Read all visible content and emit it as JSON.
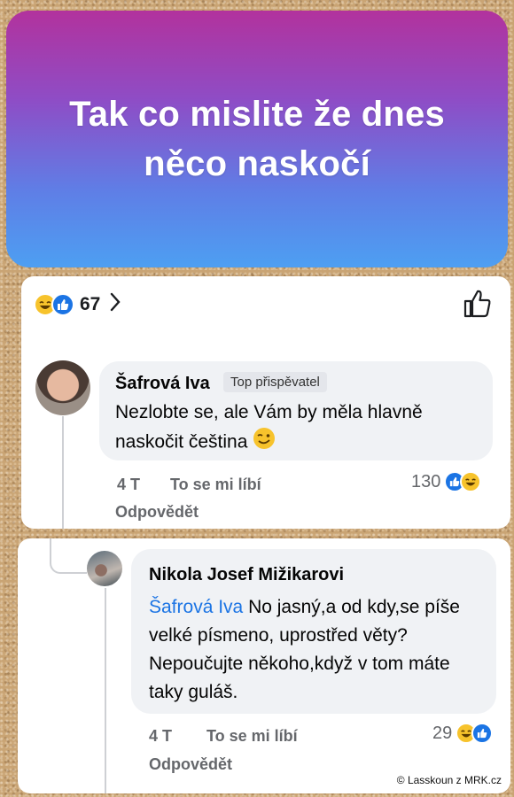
{
  "banner": {
    "text": "Tak co mislite že dnes něco naskočí"
  },
  "post": {
    "reaction_count": "67"
  },
  "comment1": {
    "author": "Šafrová Iva",
    "badge": "Top přispěvatel",
    "text": "Nezlobte se, ale Vám by měla hlavně naskočit čeština",
    "time": "4 T",
    "like_label": "To se mi líbí",
    "reply_label": "Odpovědět",
    "reaction_count": "130"
  },
  "comment2": {
    "author": "Nikola Josef Mižikarovi",
    "mention": "Šafrová Iva",
    "text": " No jasný,a od kdy,se píše velké písmeno, uprostřed věty? Nepoučujte někoho,když v tom máte taky guláš.",
    "time": "4 T",
    "like_label": "To se mi líbí",
    "reply_label": "Odpovědět",
    "reaction_count": "29"
  },
  "watermark": "© Lasskoun z MRK.cz",
  "colors": {
    "like_blue": "#1b74e4",
    "haha_yellow": "#f7c32c",
    "bubble_bg": "#f0f2f5"
  },
  "icons": [
    "haha-emoji-icon",
    "like-emoji-icon",
    "chevron-right-icon",
    "thumbs-up-outline-icon",
    "wink-emoji-icon"
  ]
}
